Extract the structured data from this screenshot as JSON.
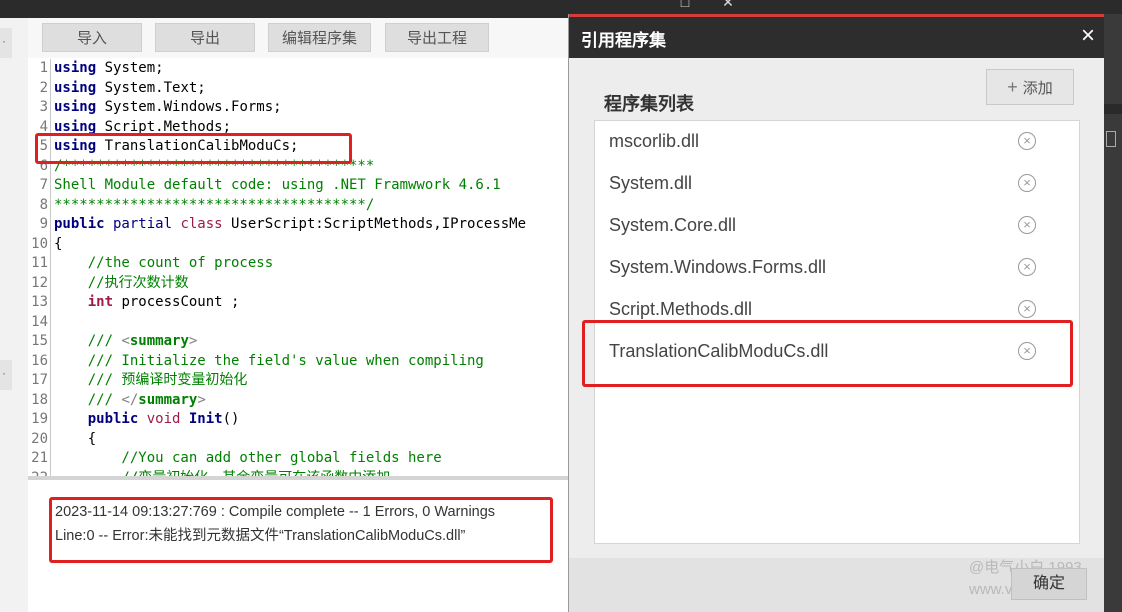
{
  "toolbar": {
    "import_label": "导入",
    "export_label": "导出",
    "edit_assemblies_label": "编辑程序集",
    "export_project_label": "导出工程"
  },
  "code_lines": [
    {
      "n": "1",
      "tokens": [
        {
          "t": "using",
          "c": "kw"
        },
        {
          "t": " System;",
          "c": "code"
        }
      ]
    },
    {
      "n": "2",
      "tokens": [
        {
          "t": "using",
          "c": "kw"
        },
        {
          "t": " System.Text;",
          "c": "code"
        }
      ]
    },
    {
      "n": "3",
      "tokens": [
        {
          "t": "using",
          "c": "kw"
        },
        {
          "t": " System.Windows.Forms;",
          "c": "code"
        }
      ]
    },
    {
      "n": "4",
      "tokens": [
        {
          "t": "using",
          "c": "kw"
        },
        {
          "t": " Script.Methods;",
          "c": "code"
        }
      ]
    },
    {
      "n": "5",
      "tokens": [
        {
          "t": "using",
          "c": "kw"
        },
        {
          "t": " TranslationCalibModuCs;",
          "c": "code"
        }
      ]
    },
    {
      "n": "6",
      "tokens": [
        {
          "t": "/*************************************",
          "c": "cm"
        }
      ]
    },
    {
      "n": "7",
      "tokens": [
        {
          "t": "Shell Module default code: using .NET Framwwork 4.6.1",
          "c": "cm"
        }
      ]
    },
    {
      "n": "8",
      "tokens": [
        {
          "t": "*************************************/",
          "c": "cm"
        }
      ]
    },
    {
      "n": "9",
      "tokens": [
        {
          "t": "public",
          "c": "kw"
        },
        {
          "t": " partial ",
          "c": "kw3"
        },
        {
          "t": "class",
          "c": "kw2"
        },
        {
          "t": " UserScript:ScriptMethods,IProcessMe",
          "c": "code"
        }
      ]
    },
    {
      "n": "10",
      "tokens": [
        {
          "t": "{",
          "c": "code"
        }
      ]
    },
    {
      "n": "11",
      "tokens": [
        {
          "t": "    //the count of process",
          "c": "cm"
        }
      ]
    },
    {
      "n": "12",
      "tokens": [
        {
          "t": "    //执行次数计数",
          "c": "cm"
        }
      ]
    },
    {
      "n": "13",
      "tokens": [
        {
          "t": "    ",
          "c": "code"
        },
        {
          "t": "int",
          "c": "kw2b"
        },
        {
          "t": " processCount ;",
          "c": "code"
        }
      ]
    },
    {
      "n": "14",
      "tokens": [
        {
          "t": "",
          "c": "code"
        }
      ]
    },
    {
      "n": "15",
      "tokens": [
        {
          "t": "    /// ",
          "c": "cm"
        },
        {
          "t": "<",
          "c": "tag"
        },
        {
          "t": "summary",
          "c": "cmb"
        },
        {
          "t": ">",
          "c": "tag"
        }
      ]
    },
    {
      "n": "16",
      "tokens": [
        {
          "t": "    /// Initialize the field's value when compiling",
          "c": "cm"
        }
      ]
    },
    {
      "n": "17",
      "tokens": [
        {
          "t": "    /// 预编译时变量初始化",
          "c": "cm"
        }
      ]
    },
    {
      "n": "18",
      "tokens": [
        {
          "t": "    /// ",
          "c": "cm"
        },
        {
          "t": "</",
          "c": "tag"
        },
        {
          "t": "summary",
          "c": "cmb"
        },
        {
          "t": ">",
          "c": "tag"
        }
      ]
    },
    {
      "n": "19",
      "tokens": [
        {
          "t": "    ",
          "c": "code"
        },
        {
          "t": "public",
          "c": "kw"
        },
        {
          "t": " void ",
          "c": "kw2"
        },
        {
          "t": "Init",
          "c": "fn"
        },
        {
          "t": "()",
          "c": "code"
        }
      ]
    },
    {
      "n": "20",
      "tokens": [
        {
          "t": "    {",
          "c": "code"
        }
      ]
    },
    {
      "n": "21",
      "tokens": [
        {
          "t": "        //You can add other global fields here",
          "c": "cm"
        }
      ]
    },
    {
      "n": "22",
      "tokens": [
        {
          "t": "        //变量初始化，其余变量可在该函数中添加",
          "c": "cm"
        }
      ]
    }
  ],
  "output": {
    "line1": "2023-11-14 09:13:27:769 : Compile complete -- 1 Errors, 0 Warnings",
    "line2": "Line:0 -- Error:未能找到元数据文件“TranslationCalibModuCs.dll”"
  },
  "dialog": {
    "title": "引用程序集",
    "close_icon": "×",
    "list_label": "程序集列表",
    "add_icon": "+",
    "add_label": "添加",
    "assemblies": [
      "mscorlib.dll",
      "System.dll",
      "System.Core.dll",
      "System.Windows.Forms.dll",
      "Script.Methods.dll",
      "TranslationCalibModuCs.dll"
    ],
    "remove_icon": "⊗",
    "ok_label": "确定"
  },
  "watermark": {
    "line1": "@电气小白 1993",
    "line2": "www.vi...com"
  },
  "colors": {
    "highlight_red": "#e02020",
    "dialog_header": "#2d2d2d",
    "keyword_blue": "#000080",
    "keyword_maroon": "#9b1c48",
    "comment_green": "#008000"
  }
}
